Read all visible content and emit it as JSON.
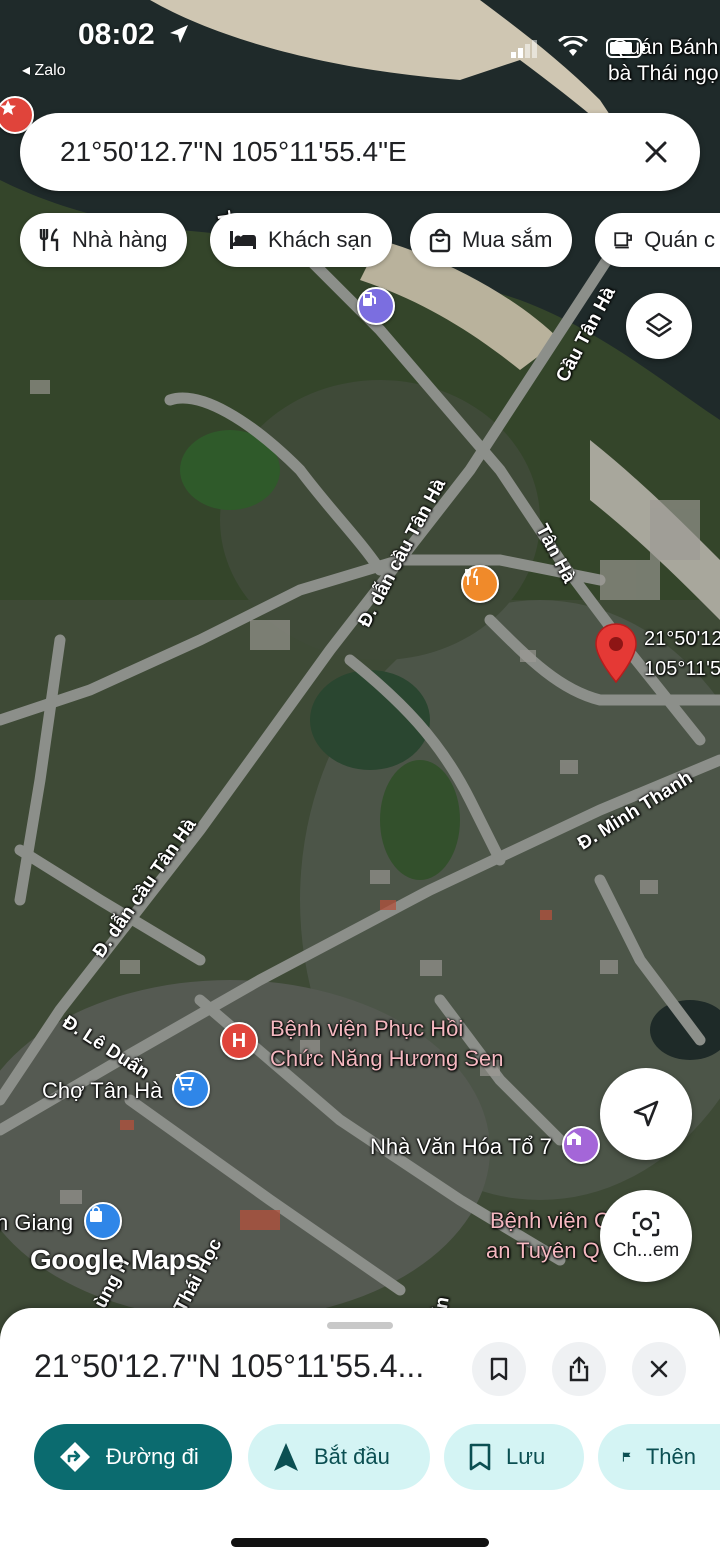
{
  "status_bar": {
    "time": "08:02",
    "back_app": "◂ Zalo"
  },
  "search": {
    "query": "21°50'12.7\"N 105°11'55.4\"E"
  },
  "chips": [
    {
      "label": "Nhà hàng",
      "icon": "fork-knife-icon"
    },
    {
      "label": "Khách sạn",
      "icon": "bed-icon"
    },
    {
      "label": "Mua sắm",
      "icon": "shopping-bag-icon"
    },
    {
      "label": "Quán c",
      "icon": "coffee-icon"
    }
  ],
  "map": {
    "road_labels": {
      "cau_tan_ha": "Cầu Tân Hà",
      "dan_cau_1": "Đ. dẫn cầu Tân Hà",
      "dan_cau_2": "Đ. dẫn cầu Tân Hà",
      "tan_ha": "Tân Hà",
      "minh_thanh": "Đ. Minh Thanh",
      "le_duan": "Đ. Lê Duẩn",
      "top_road": "Tâ",
      "bottom_1": "ùng H",
      "bottom_2": "Thái Học",
      "bottom_3": "ẩn"
    },
    "pois": {
      "top_right_1": "Quán Bánh",
      "top_right_2": "bà Thái ngọ",
      "hospital_1": "Bệnh viện Phục Hồi",
      "hospital_2": "Chức Năng Hương Sen",
      "market": "Chợ Tân Hà",
      "culture_house": "Nhà Văn Hóa Tổ 7",
      "police_hospital_1": "Bệnh viện C",
      "police_hospital_2": "an Tuyên Q",
      "giang": "n Giang"
    },
    "pin_label": {
      "line1": "21°50'12",
      "line2": "105°11'5"
    },
    "watermark": "Google Maps",
    "camera_label": "Ch...em"
  },
  "sheet": {
    "title": "21°50'12.7\"N 105°11'55.4...",
    "actions": [
      {
        "label": "Đường đi",
        "icon": "directions-icon"
      },
      {
        "label": "Bắt đầu",
        "icon": "navigation-arrow-icon"
      },
      {
        "label": "Lưu",
        "icon": "bookmark-icon"
      },
      {
        "label": "Thên",
        "icon": "flag-icon"
      }
    ]
  },
  "colors": {
    "primary_action": "#0b6b6f",
    "secondary_action": "#d4f4f4",
    "pin": "#e53935"
  }
}
